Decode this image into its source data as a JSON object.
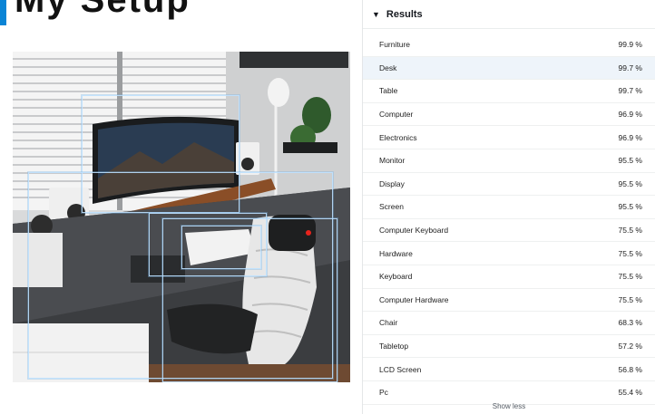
{
  "header": {
    "cut_title": "My Setup"
  },
  "results": {
    "title": "Results",
    "show_less_label": "Show less",
    "items": [
      {
        "label": "Furniture",
        "confidence": "99.9 %"
      },
      {
        "label": "Desk",
        "confidence": "99.7 %"
      },
      {
        "label": "Table",
        "confidence": "99.7 %"
      },
      {
        "label": "Computer",
        "confidence": "96.9 %"
      },
      {
        "label": "Electronics",
        "confidence": "96.9 %"
      },
      {
        "label": "Monitor",
        "confidence": "95.5 %"
      },
      {
        "label": "Display",
        "confidence": "95.5 %"
      },
      {
        "label": "Screen",
        "confidence": "95.5 %"
      },
      {
        "label": "Computer Keyboard",
        "confidence": "75.5 %"
      },
      {
        "label": "Hardware",
        "confidence": "75.5 %"
      },
      {
        "label": "Keyboard",
        "confidence": "75.5 %"
      },
      {
        "label": "Computer Hardware",
        "confidence": "75.5 %"
      },
      {
        "label": "Chair",
        "confidence": "68.3 %"
      },
      {
        "label": "Tabletop",
        "confidence": "57.2 %"
      },
      {
        "label": "LCD Screen",
        "confidence": "56.8 %"
      },
      {
        "label": "Pc",
        "confidence": "55.4 %"
      }
    ]
  },
  "colors": {
    "accent": "#0a84d6",
    "highlight_row": "#eef4fa",
    "marker": "#e8231c"
  }
}
